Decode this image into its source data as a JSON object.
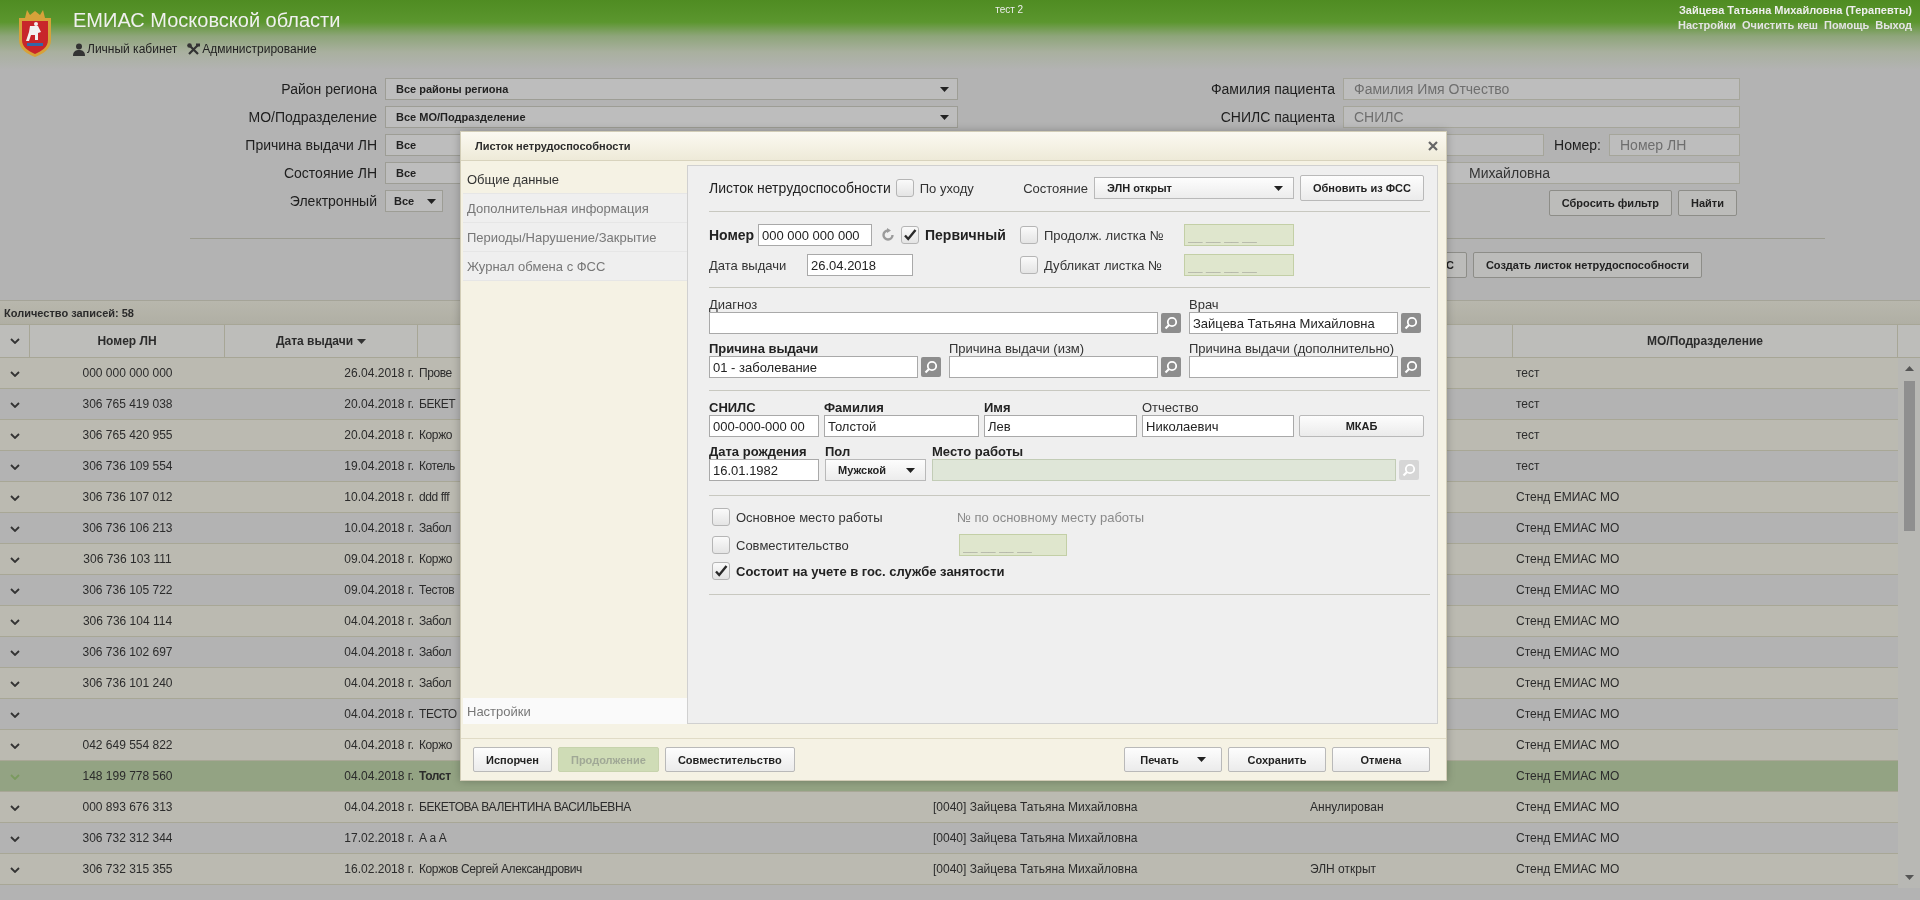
{
  "header": {
    "title": "ЕМИАС Московской области",
    "env": "тест 2",
    "user": "Зайцева Татьяна Михайловна (Терапевты)",
    "links": [
      "Настройки",
      "Очистить кеш",
      "Помощь",
      "Выход"
    ],
    "nav": [
      {
        "label": "Личный кабинет",
        "kind": "person"
      },
      {
        "label": "Администрирование",
        "kind": "tools"
      }
    ]
  },
  "filters": {
    "left": [
      {
        "label": "Район региона",
        "value": "Все районы региона",
        "kind": "wide"
      },
      {
        "label": "МО/Подразделение",
        "value": "Все МО/Подразделение",
        "kind": "wide"
      },
      {
        "label": "Причина выдачи ЛН",
        "value": "Все",
        "kind": "wide"
      },
      {
        "label": "Состояние ЛН",
        "value": "Все",
        "kind": "wide"
      },
      {
        "label": "Электронный",
        "value": "Все",
        "kind": "short"
      }
    ],
    "right": [
      {
        "label": "Фамилия пациента",
        "placeholder": "Фамилия Имя Отчество"
      },
      {
        "label": "СНИЛС пациента",
        "placeholder": "СНИЛС"
      }
    ],
    "number": {
      "label": "Номер:",
      "placeholder": "Номер ЛН"
    },
    "doctor_value": "Михайловна",
    "buttons": [
      "Сбросить фильтр",
      "Найти"
    ]
  },
  "actions": [
    "С",
    "Создать листок нетрудоспособности"
  ],
  "table": {
    "count": "Количество записей: 58",
    "columns": [
      {
        "label": "Номер ЛН",
        "sorted": false
      },
      {
        "label": "Дата выдачи",
        "sorted": true
      },
      {
        "label": "МО/Подразделение",
        "sorted": false
      }
    ],
    "rows": [
      {
        "number": "000 000 000 000",
        "date": "26.04.2018 г.",
        "patient": "Прове",
        "mo": "тест",
        "selected": false
      },
      {
        "number": "306 765 419 038",
        "date": "20.04.2018 г.",
        "patient": "БЕКЕТ",
        "mo": "тест",
        "selected": false
      },
      {
        "number": "306 765 420 955",
        "date": "20.04.2018 г.",
        "patient": "Коржо",
        "mo": "тест",
        "selected": false
      },
      {
        "number": "306 736 109 554",
        "date": "19.04.2018 г.",
        "patient": "Котель",
        "mo": "тест",
        "selected": false
      },
      {
        "number": "306 736 107 012",
        "date": "10.04.2018 г.",
        "patient": "ddd fff",
        "mo": "Стенд ЕМИАС МО",
        "selected": false
      },
      {
        "number": "306 736 106 213",
        "date": "10.04.2018 г.",
        "patient": "Забол",
        "mo": "Стенд ЕМИАС МО",
        "selected": false
      },
      {
        "number": "306 736 103 111",
        "date": "09.04.2018 г.",
        "patient": "Коржо",
        "mo": "Стенд ЕМИАС МО",
        "selected": false
      },
      {
        "number": "306 736 105 722",
        "date": "09.04.2018 г.",
        "patient": "Тестов",
        "mo": "Стенд ЕМИАС МО",
        "selected": false
      },
      {
        "number": "306 736 104 114",
        "date": "04.04.2018 г.",
        "patient": "Забол",
        "mo": "Стенд ЕМИАС МО",
        "selected": false
      },
      {
        "number": "306 736 102 697",
        "date": "04.04.2018 г.",
        "patient": "Забол",
        "mo": "Стенд ЕМИАС МО",
        "selected": false
      },
      {
        "number": "306 736 101 240",
        "date": "04.04.2018 г.",
        "patient": "Забол",
        "mo": "Стенд ЕМИАС МО",
        "selected": false
      },
      {
        "date": "04.04.2018 г.",
        "patient": "ТЕСТО",
        "mo": "Стенд ЕМИАС МО",
        "selected": false
      },
      {
        "number": "042 649 554 822",
        "date": "04.04.2018 г.",
        "patient": "Коржо",
        "mo": "Стенд ЕМИАС МО",
        "selected": false
      },
      {
        "number": "148 199 778 560",
        "date": "04.04.2018 г.",
        "patient": "Толст",
        "mo": "Стенд ЕМИАС МО",
        "selected": true
      },
      {
        "number": "000 893 676 313",
        "date": "04.04.2018 г.",
        "patient": "БЕКЕТОВА ВАЛЕНТИНА ВАСИЛЬЕВНА",
        "doctor": "[0040] Зайцева Татьяна Михайловна",
        "status": "Аннулирован",
        "mo": "Стенд ЕМИАС МО",
        "selected": false
      },
      {
        "number": "306 732 312 344",
        "date": "17.02.2018 г.",
        "patient": "А а А",
        "doctor": "[0040] Зайцева Татьяна Михайловна",
        "mo": "Стенд ЕМИАС МО",
        "selected": false
      },
      {
        "number": "306 732 315 355",
        "date": "16.02.2018 г.",
        "patient": "Коржов Сергей Александрович",
        "doctor": "[0040] Зайцева Татьяна Михайловна",
        "status": "ЭЛН открыт",
        "mo": "Стенд ЕМИАС МО",
        "selected": false
      }
    ]
  },
  "modal": {
    "title": "Листок нетрудоспособности",
    "nav": [
      {
        "label": "Общие данные",
        "selected": true
      },
      {
        "label": "Дополнительная информация",
        "selected": false
      },
      {
        "label": "Периоды/Нарушение/Закрытие",
        "selected": false
      },
      {
        "label": "Журнал обмена с ФСС",
        "selected": false
      }
    ],
    "nav_bottom": "Настройки",
    "heading": "Листок нетрудоспособности",
    "care": {
      "label": "По уходу",
      "checked": false
    },
    "state": {
      "label": "Состояние",
      "value": "ЭЛН открыт"
    },
    "refresh_button": "Обновить из ФСС",
    "number": {
      "label": "Номер",
      "value": "000 000 000 000",
      "required": true
    },
    "primary": {
      "label": "Первичный",
      "checked": true
    },
    "continuation": {
      "label": "Продолж. листка №",
      "checked": false,
      "placeholder": "__ __ __ __"
    },
    "issue_date": {
      "label": "Дата выдачи",
      "value": "26.04.2018",
      "required": false
    },
    "duplicate": {
      "label": "Дубликат листка №",
      "checked": false,
      "placeholder": "__ __ __ __"
    },
    "diagnosis": {
      "label": "Диагноз",
      "required": false
    },
    "doctor": {
      "label": "Врач",
      "value": "Зайцева Татьяна Михайловна",
      "required": false
    },
    "reasons": [
      {
        "label": "Причина выдачи",
        "value": "01 - заболевание",
        "required": true
      },
      {
        "label": "Причина выдачи (изм)",
        "required": false
      },
      {
        "label": "Причина выдачи (дополнительно)",
        "required": false
      }
    ],
    "person": [
      {
        "label": "СНИЛС",
        "value": "000-000-000 00",
        "required": true
      },
      {
        "label": "Фамилия",
        "value": "Толстой",
        "required": true
      },
      {
        "label": "Имя",
        "value": "Лев",
        "required": true
      },
      {
        "label": "Отчество",
        "value": "Николаевич",
        "required": false
      }
    ],
    "mkab_button": "МКАБ",
    "birth": {
      "label": "Дата рождения",
      "value": "16.01.1982",
      "required": true
    },
    "sex": {
      "label": "Пол",
      "value": "Мужской",
      "required": true
    },
    "workplace": {
      "label": "Место работы",
      "required": true,
      "disabled": true
    },
    "main_work": {
      "label": "Основное место работы",
      "checked": false
    },
    "main_work_no": "№ по основному месту работы",
    "part_time": {
      "label": "Совместительство",
      "checked": false,
      "placeholder": "__ __ __ __"
    },
    "employment": {
      "label": "Состоит на учете в гос. службе занятости",
      "checked": true
    },
    "footer_left": [
      {
        "label": "Испорчен",
        "disabled": false
      },
      {
        "label": "Продолжение",
        "disabled": true
      },
      {
        "label": "Совместительство",
        "disabled": false
      }
    ],
    "footer_right": [
      {
        "label": "Печать",
        "kind": "menu"
      },
      {
        "label": "Сохранить",
        "kind": "plain"
      },
      {
        "label": "Отмена",
        "kind": "plain"
      }
    ]
  }
}
